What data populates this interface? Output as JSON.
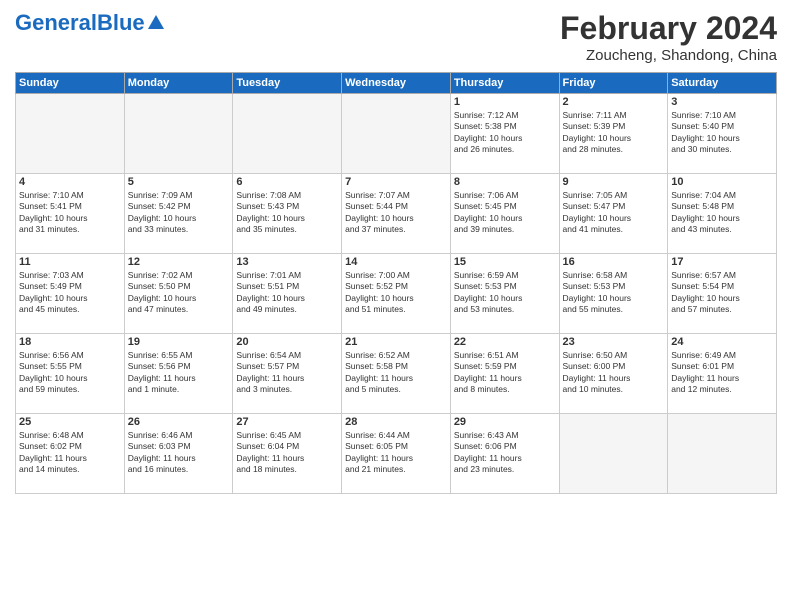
{
  "header": {
    "logo_general": "General",
    "logo_blue": "Blue",
    "month_title": "February 2024",
    "location": "Zoucheng, Shandong, China"
  },
  "weekdays": [
    "Sunday",
    "Monday",
    "Tuesday",
    "Wednesday",
    "Thursday",
    "Friday",
    "Saturday"
  ],
  "weeks": [
    [
      {
        "num": "",
        "info": ""
      },
      {
        "num": "",
        "info": ""
      },
      {
        "num": "",
        "info": ""
      },
      {
        "num": "",
        "info": ""
      },
      {
        "num": "1",
        "info": "Sunrise: 7:12 AM\nSunset: 5:38 PM\nDaylight: 10 hours\nand 26 minutes."
      },
      {
        "num": "2",
        "info": "Sunrise: 7:11 AM\nSunset: 5:39 PM\nDaylight: 10 hours\nand 28 minutes."
      },
      {
        "num": "3",
        "info": "Sunrise: 7:10 AM\nSunset: 5:40 PM\nDaylight: 10 hours\nand 30 minutes."
      }
    ],
    [
      {
        "num": "4",
        "info": "Sunrise: 7:10 AM\nSunset: 5:41 PM\nDaylight: 10 hours\nand 31 minutes."
      },
      {
        "num": "5",
        "info": "Sunrise: 7:09 AM\nSunset: 5:42 PM\nDaylight: 10 hours\nand 33 minutes."
      },
      {
        "num": "6",
        "info": "Sunrise: 7:08 AM\nSunset: 5:43 PM\nDaylight: 10 hours\nand 35 minutes."
      },
      {
        "num": "7",
        "info": "Sunrise: 7:07 AM\nSunset: 5:44 PM\nDaylight: 10 hours\nand 37 minutes."
      },
      {
        "num": "8",
        "info": "Sunrise: 7:06 AM\nSunset: 5:45 PM\nDaylight: 10 hours\nand 39 minutes."
      },
      {
        "num": "9",
        "info": "Sunrise: 7:05 AM\nSunset: 5:47 PM\nDaylight: 10 hours\nand 41 minutes."
      },
      {
        "num": "10",
        "info": "Sunrise: 7:04 AM\nSunset: 5:48 PM\nDaylight: 10 hours\nand 43 minutes."
      }
    ],
    [
      {
        "num": "11",
        "info": "Sunrise: 7:03 AM\nSunset: 5:49 PM\nDaylight: 10 hours\nand 45 minutes."
      },
      {
        "num": "12",
        "info": "Sunrise: 7:02 AM\nSunset: 5:50 PM\nDaylight: 10 hours\nand 47 minutes."
      },
      {
        "num": "13",
        "info": "Sunrise: 7:01 AM\nSunset: 5:51 PM\nDaylight: 10 hours\nand 49 minutes."
      },
      {
        "num": "14",
        "info": "Sunrise: 7:00 AM\nSunset: 5:52 PM\nDaylight: 10 hours\nand 51 minutes."
      },
      {
        "num": "15",
        "info": "Sunrise: 6:59 AM\nSunset: 5:53 PM\nDaylight: 10 hours\nand 53 minutes."
      },
      {
        "num": "16",
        "info": "Sunrise: 6:58 AM\nSunset: 5:53 PM\nDaylight: 10 hours\nand 55 minutes."
      },
      {
        "num": "17",
        "info": "Sunrise: 6:57 AM\nSunset: 5:54 PM\nDaylight: 10 hours\nand 57 minutes."
      }
    ],
    [
      {
        "num": "18",
        "info": "Sunrise: 6:56 AM\nSunset: 5:55 PM\nDaylight: 10 hours\nand 59 minutes."
      },
      {
        "num": "19",
        "info": "Sunrise: 6:55 AM\nSunset: 5:56 PM\nDaylight: 11 hours\nand 1 minute."
      },
      {
        "num": "20",
        "info": "Sunrise: 6:54 AM\nSunset: 5:57 PM\nDaylight: 11 hours\nand 3 minutes."
      },
      {
        "num": "21",
        "info": "Sunrise: 6:52 AM\nSunset: 5:58 PM\nDaylight: 11 hours\nand 5 minutes."
      },
      {
        "num": "22",
        "info": "Sunrise: 6:51 AM\nSunset: 5:59 PM\nDaylight: 11 hours\nand 8 minutes."
      },
      {
        "num": "23",
        "info": "Sunrise: 6:50 AM\nSunset: 6:00 PM\nDaylight: 11 hours\nand 10 minutes."
      },
      {
        "num": "24",
        "info": "Sunrise: 6:49 AM\nSunset: 6:01 PM\nDaylight: 11 hours\nand 12 minutes."
      }
    ],
    [
      {
        "num": "25",
        "info": "Sunrise: 6:48 AM\nSunset: 6:02 PM\nDaylight: 11 hours\nand 14 minutes."
      },
      {
        "num": "26",
        "info": "Sunrise: 6:46 AM\nSunset: 6:03 PM\nDaylight: 11 hours\nand 16 minutes."
      },
      {
        "num": "27",
        "info": "Sunrise: 6:45 AM\nSunset: 6:04 PM\nDaylight: 11 hours\nand 18 minutes."
      },
      {
        "num": "28",
        "info": "Sunrise: 6:44 AM\nSunset: 6:05 PM\nDaylight: 11 hours\nand 21 minutes."
      },
      {
        "num": "29",
        "info": "Sunrise: 6:43 AM\nSunset: 6:06 PM\nDaylight: 11 hours\nand 23 minutes."
      },
      {
        "num": "",
        "info": ""
      },
      {
        "num": "",
        "info": ""
      }
    ]
  ]
}
